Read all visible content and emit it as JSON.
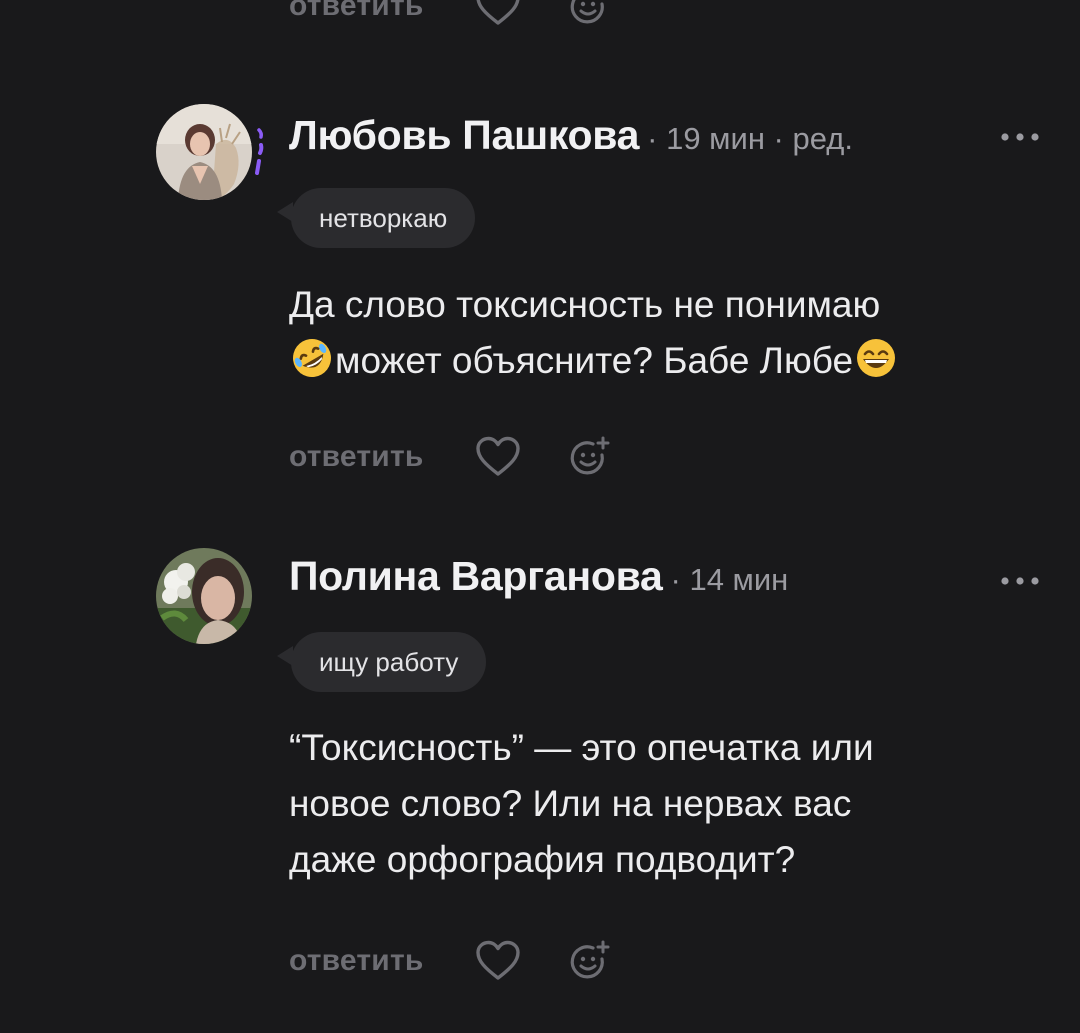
{
  "actions_common": {
    "reply_label": "ответить"
  },
  "comments": [
    {
      "author": "Любовь Пашкова",
      "meta": "· 19 мин · ред.",
      "tag": "нетворкаю",
      "text_line1": "Да слово токсисность не понимаю",
      "text_line2": "может объясните? Бабе Любе",
      "emoji1": "rolling-on-floor-laughing-emoji",
      "emoji2": "grinning-smiling-eyes-emoji"
    },
    {
      "author": "Полина Варганова",
      "meta": "· 14 мин",
      "tag": "ищу работу",
      "text_line1": "“Токсисность” — это опечатка или",
      "text_line2": "новое слово? Или на нервах вас",
      "text_line3": "даже орфография подводит?"
    }
  ],
  "colors": {
    "background": "#19191b",
    "text": "#ececee",
    "muted": "#9b9ba1",
    "action": "#6d6d73",
    "tag_bg": "#2b2b2e",
    "story_ring": "#8b5cf6"
  }
}
